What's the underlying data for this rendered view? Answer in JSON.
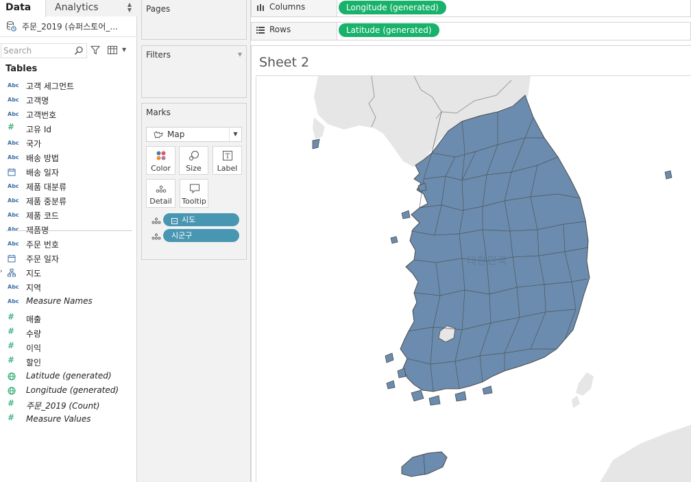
{
  "tabs": {
    "data": "Data",
    "analytics": "Analytics"
  },
  "datasource": {
    "name": "주문_2019 (슈퍼스토어_...",
    "icon": "datasource-icon"
  },
  "search": {
    "placeholder": "Search"
  },
  "tables_heading": "Tables",
  "dimensions": [
    {
      "type": "Abc",
      "label": "고객 세그먼트"
    },
    {
      "type": "Abc",
      "label": "고객명"
    },
    {
      "type": "Abc",
      "label": "고객번호"
    },
    {
      "type": "#",
      "label": "고유 Id"
    },
    {
      "type": "Abc",
      "label": "국가"
    },
    {
      "type": "Abc",
      "label": "배송 방법"
    },
    {
      "type": "date",
      "label": "배송 일자"
    },
    {
      "type": "Abc",
      "label": "제품 대분류"
    },
    {
      "type": "Abc",
      "label": "제품 중분류"
    },
    {
      "type": "Abc",
      "label": "제품 코드"
    },
    {
      "type": "Abc",
      "label": "제품명"
    },
    {
      "type": "Abc",
      "label": "주문 번호"
    },
    {
      "type": "date",
      "label": "주문 일자"
    },
    {
      "type": "hierarchy",
      "label": "지도"
    },
    {
      "type": "Abc",
      "label": "지역"
    },
    {
      "type": "Abc",
      "label": "Measure Names",
      "italic": true
    }
  ],
  "measures": [
    {
      "type": "#",
      "label": "매출"
    },
    {
      "type": "#",
      "label": "수량"
    },
    {
      "type": "#",
      "label": "이익"
    },
    {
      "type": "#",
      "label": "할인"
    },
    {
      "type": "globe",
      "label": "Latitude (generated)",
      "italic": true
    },
    {
      "type": "globe",
      "label": "Longitude (generated)",
      "italic": true
    },
    {
      "type": "#",
      "label": "주문_2019 (Count)",
      "italic": true
    },
    {
      "type": "#",
      "label": "Measure Values",
      "italic": true
    }
  ],
  "cards": {
    "pages": "Pages",
    "filters": "Filters",
    "marks": "Marks",
    "mark_type": "Map",
    "buttons": {
      "color": "Color",
      "size": "Size",
      "label": "Label",
      "detail": "Detail",
      "tooltip": "Tooltip"
    },
    "pills": [
      "시도",
      "시군구"
    ]
  },
  "shelves": {
    "columns_title": "Columns",
    "columns_pill": "Longitude (generated)",
    "rows_title": "Rows",
    "rows_pill": "Latitude (generated)"
  },
  "sheet": {
    "title": "Sheet 2",
    "map_label": "대한민국",
    "land_color": "#e6e6e6",
    "region_color": "#6b8cae",
    "region_border": "#4a4a4a"
  },
  "colors": {
    "pill_dimension": "#4996b2",
    "pill_continuous": "#18b26a",
    "field_dimension": "#3b6fa6",
    "field_measure": "#12a05f"
  }
}
